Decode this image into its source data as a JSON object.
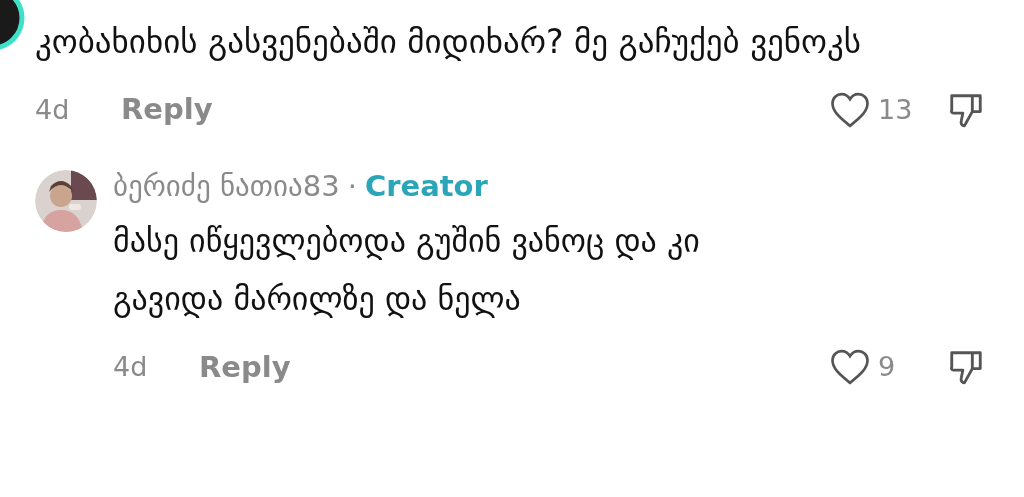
{
  "comments": [
    {
      "kind": "top",
      "text": "კობახიხის გასვენებაში მიდიხარ? მე გაჩუქებ ვენოკს",
      "age": "4d",
      "reply": "Reply",
      "likes": "13"
    },
    {
      "kind": "reply",
      "author": "ბერიძე ნათია83",
      "separator": "·",
      "creator_label": "Creator",
      "text": "მასე იწყევლებოდა გუშინ ვანოც და კი გავიდა მარილზე და ნელა",
      "age": "4d",
      "reply": "Reply",
      "likes": "9"
    }
  ]
}
